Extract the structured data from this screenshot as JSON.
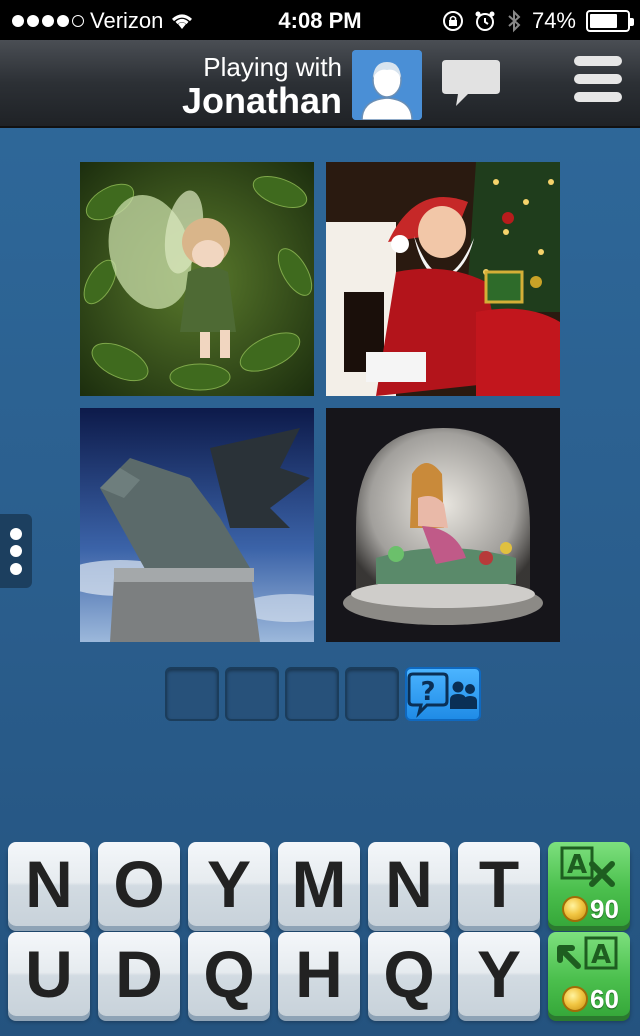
{
  "status_bar": {
    "carrier": "Verizon",
    "time": "4:08 PM",
    "battery": "74%",
    "battery_level": 0.74
  },
  "header": {
    "playing_with_label": "Playing with",
    "player_name": "Jonathan"
  },
  "photos": [
    {
      "name": "photo-fairy"
    },
    {
      "name": "photo-santa"
    },
    {
      "name": "photo-dragon"
    },
    {
      "name": "photo-mermaid-snowglobe"
    }
  ],
  "answer": {
    "slots": [
      "",
      "",
      "",
      ""
    ]
  },
  "letters": {
    "row1": [
      "N",
      "O",
      "Y",
      "M",
      "N",
      "T"
    ],
    "row2": [
      "U",
      "D",
      "Q",
      "H",
      "Q",
      "Y"
    ]
  },
  "powerups": {
    "remove_letters_cost": "90",
    "reveal_letter_cost": "60"
  },
  "icons": {
    "chat": "chat-bubble-icon",
    "menu": "hamburger-menu-icon",
    "hint": "ask-friends-icon",
    "coin": "coin-icon"
  }
}
